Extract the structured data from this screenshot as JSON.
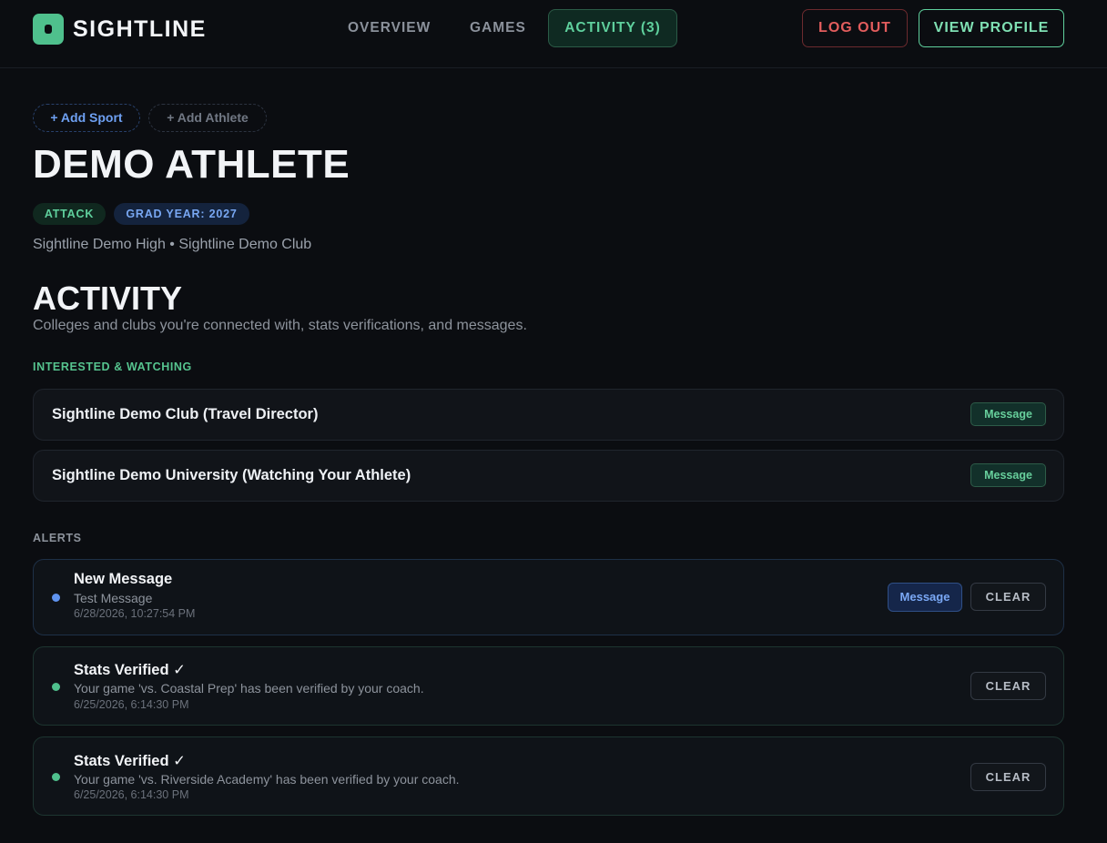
{
  "header": {
    "brand": "SIGHTLINE",
    "nav": {
      "overview": "OVERVIEW",
      "games": "GAMES",
      "activity": "ACTIVITY (3)"
    },
    "logout_label": "LOG OUT",
    "profile_label": "VIEW PROFILE"
  },
  "profile": {
    "add_sport": "+ Add Sport",
    "add_athlete": "+ Add Athlete",
    "name": "DEMO ATHLETE",
    "position_tag": "ATTACK",
    "grad_tag": "GRAD YEAR: 2027",
    "schools": "Sightline Demo High • Sightline Demo Club"
  },
  "activity": {
    "title": "ACTIVITY",
    "subtitle": "Colleges and clubs you're connected with, stats verifications, and messages.",
    "watching_label": "INTERESTED & WATCHING",
    "watching": [
      {
        "name": "Sightline Demo Club (Travel Director)",
        "action": "Message"
      },
      {
        "name": "Sightline Demo University (Watching Your Athlete)",
        "action": "Message"
      }
    ],
    "alerts_label": "ALERTS",
    "alerts": [
      {
        "title": "New Message",
        "body": "Test Message",
        "time": "6/28/2026, 10:27:54 PM",
        "message_label": "Message",
        "clear_label": "CLEAR",
        "dot_color": "#5f93ef"
      },
      {
        "title": "Stats Verified ✓",
        "body": "Your game 'vs. Coastal Prep' has been verified by your coach.",
        "time": "6/25/2026, 6:14:30 PM",
        "clear_label": "CLEAR",
        "dot_color": "#4fc08d"
      },
      {
        "title": "Stats Verified ✓",
        "body": "Your game 'vs. Riverside Academy' has been verified by your coach.",
        "time": "6/25/2026, 6:14:30 PM",
        "clear_label": "CLEAR",
        "dot_color": "#4fc08d"
      }
    ]
  },
  "colors": {
    "accent": "#4fc08d",
    "background": "#0b0d11",
    "danger": "#e25d5d",
    "info": "#5f93ef"
  }
}
